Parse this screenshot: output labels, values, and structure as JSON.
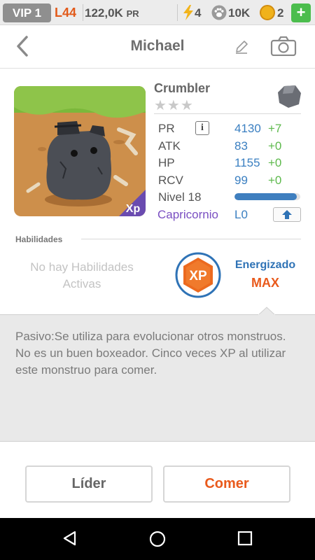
{
  "status": {
    "vip": "VIP 1",
    "level": "L44",
    "pr_value": "122,0K",
    "pr_unit": "PR",
    "energy": "4",
    "paw_count": "10K",
    "coins": "2",
    "plus": "+"
  },
  "header": {
    "title": "Michael",
    "icons": [
      "back-arrow-icon",
      "pencil-icon",
      "camera-icon"
    ]
  },
  "monster": {
    "name": "Crumbler",
    "stars": "★★★",
    "element_icon": "rock-icon",
    "stats": [
      {
        "label": "PR",
        "value": "4130",
        "bonus": "+7"
      },
      {
        "label": "ATK",
        "value": "83",
        "bonus": "+0"
      },
      {
        "label": "HP",
        "value": "1155",
        "bonus": "+0"
      },
      {
        "label": "RCV",
        "value": "99",
        "bonus": "+0"
      }
    ],
    "info": "i",
    "level_label": "Nivel 18",
    "level_progress": 0.95,
    "sign": "Capricornio",
    "sign_level": "L0",
    "xp_corner": "Xp"
  },
  "abilities": {
    "title": "Habilidades",
    "none_text": "No hay Habilidades Activas",
    "xp_badge": "XP",
    "energized_label": "Energizado",
    "energized_value": "MAX"
  },
  "description": "Pasivo:Se utiliza para evolucionar otros monstruos. No es un buen boxeador. Cinco veces XP al utilizar este monstruo para comer.",
  "buttons": {
    "leader": "Líder",
    "eat": "Comer"
  },
  "colors": {
    "accent_orange": "#e95a1c",
    "stat_blue": "#3a7fc1",
    "bonus_green": "#5db94c",
    "sign_purple": "#7a4fc2"
  }
}
